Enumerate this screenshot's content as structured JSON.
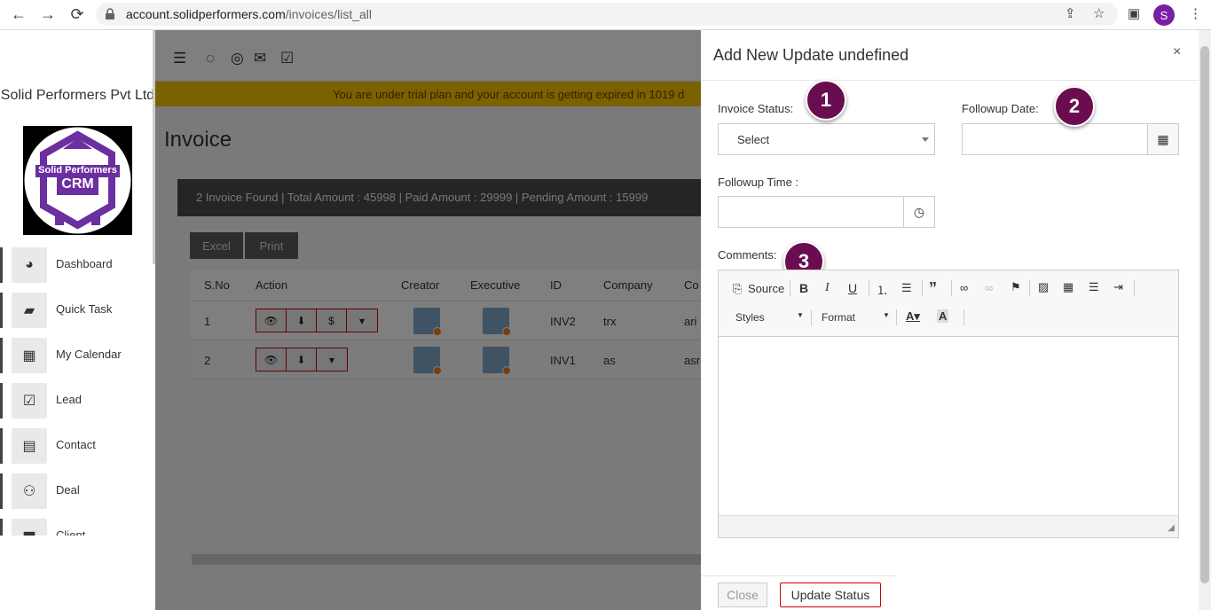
{
  "browser": {
    "url_domain": "account.solidperformers.com",
    "url_path": "/invoices/list_all",
    "profile_initial": "S"
  },
  "sidebar": {
    "company_name": "Solid Performers Pvt Ltd",
    "logo_text_top": "Solid Performers",
    "logo_text_bottom": "CRM",
    "items": [
      {
        "label": "Dashboard",
        "icon": "dashboard-icon",
        "glyph": "◕"
      },
      {
        "label": "Quick Task",
        "icon": "quick-task-icon",
        "glyph": "▰"
      },
      {
        "label": "My Calendar",
        "icon": "calendar-icon",
        "glyph": "▦"
      },
      {
        "label": "Lead",
        "icon": "lead-icon",
        "glyph": "☑"
      },
      {
        "label": "Contact",
        "icon": "contact-icon",
        "glyph": "▤"
      },
      {
        "label": "Deal",
        "icon": "handshake-icon",
        "glyph": "⚇"
      },
      {
        "label": "Client",
        "icon": "briefcase-icon",
        "glyph": "▆"
      }
    ]
  },
  "main": {
    "trial_banner": "You are under trial plan and your account is getting expired in 1019 d",
    "page_title": "Invoice",
    "summary_text": "2 Invoice Found | Total Amount : 45998 | Paid Amount : 29999 | Pending Amount : 15999",
    "excel_label": "Excel",
    "print_label": "Print",
    "table": {
      "headers": [
        "S.No",
        "Action",
        "Creator",
        "Executive",
        "ID",
        "Company",
        "Co"
      ],
      "rows": [
        {
          "sno": "1",
          "id": "INV2",
          "company": "trx",
          "contact": "ari"
        },
        {
          "sno": "2",
          "id": "INV1",
          "company": "as",
          "contact": "asr"
        }
      ]
    }
  },
  "modal": {
    "title": "Add New Update undefined",
    "close_symbol": "×",
    "invoice_status_label": "Invoice Status:",
    "invoice_status_value": "Select",
    "followup_date_label": "Followup Date:",
    "followup_time_label": "Followup Time :",
    "comments_label": "Comments:",
    "badges": [
      "1",
      "2",
      "3"
    ],
    "editor": {
      "source_label": "Source",
      "styles_label": "Styles",
      "format_label": "Format"
    },
    "close_button": "Close",
    "update_button": "Update Status"
  },
  "colors": {
    "trial_banner_bg": "#f5c400",
    "badge_bg": "#6a0d50",
    "update_border": "#cc0000",
    "logo_purple": "#6b2fa0"
  }
}
